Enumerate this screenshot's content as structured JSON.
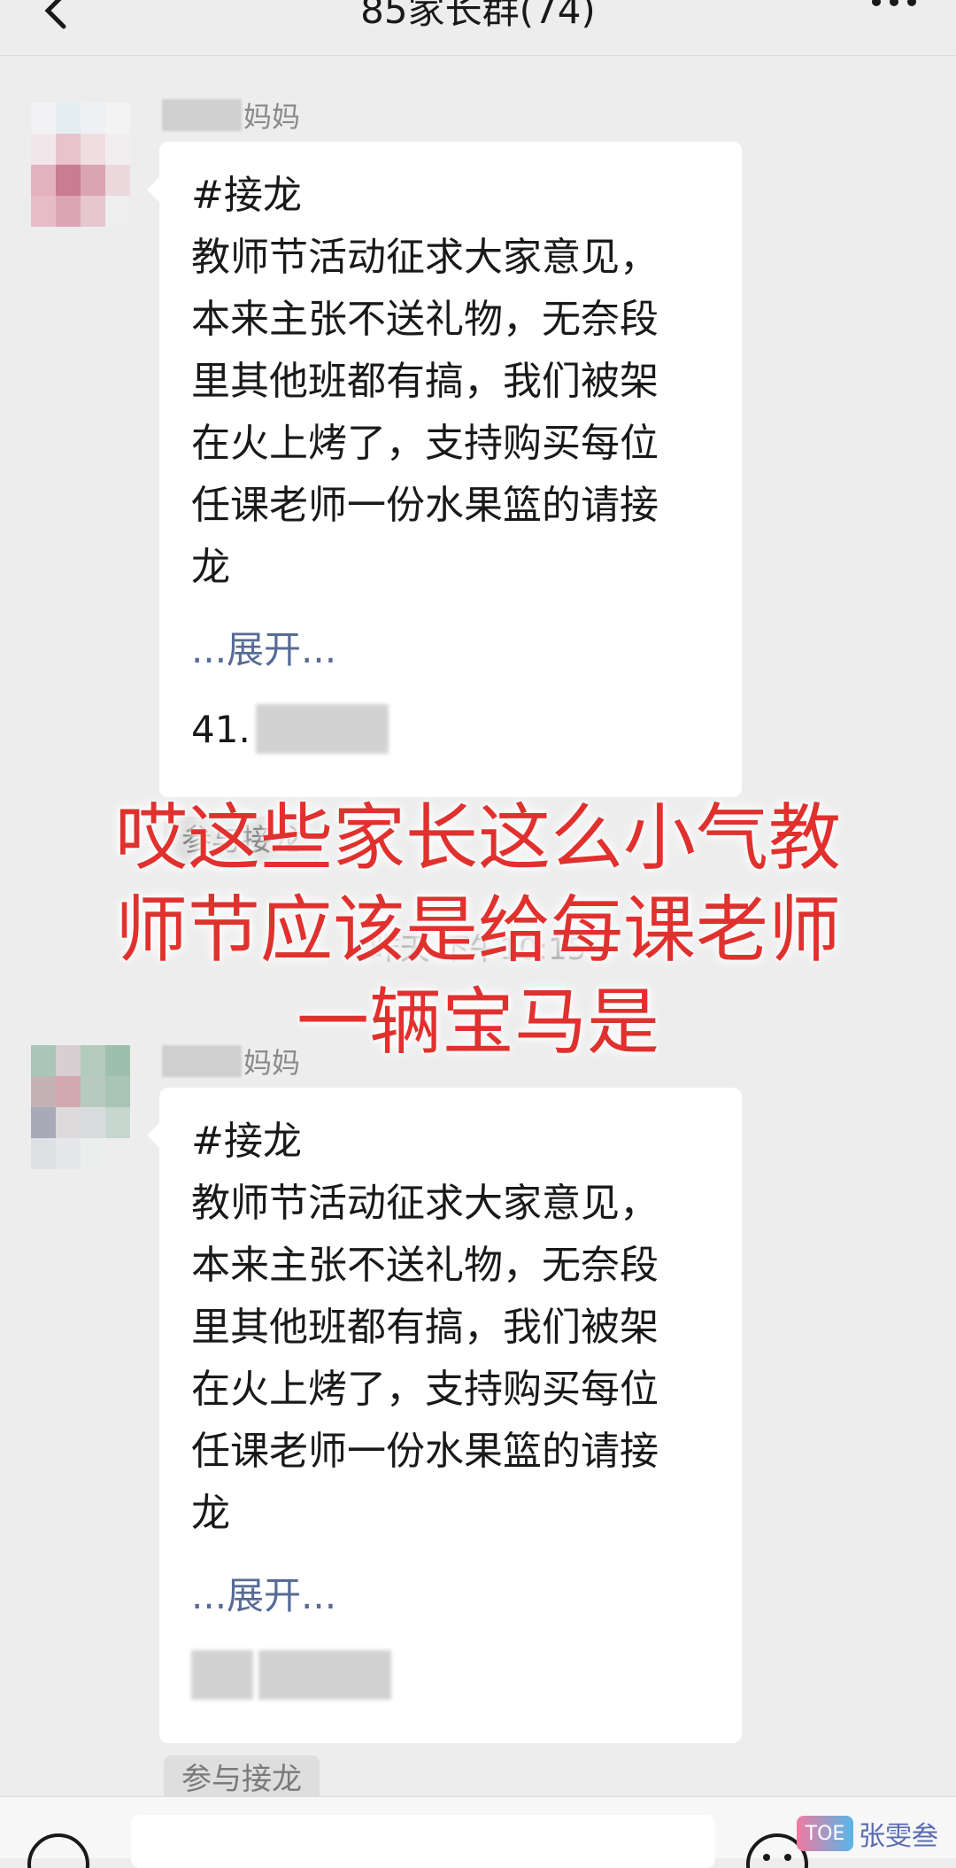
{
  "header": {
    "title": "85家长群(74)"
  },
  "messages": [
    {
      "sender_suffix": "妈妈",
      "text": "#接龙\n教师节活动征求大家意见，\n本来主张不送礼物，无奈段\n里其他班都有搞，我们被架\n在火上烤了，支持购买每位\n任课老师一份水果篮的请接\n龙",
      "expand": "...展开...",
      "entry_prefix": "41.",
      "join_label": "参与接龙"
    },
    {
      "sender_suffix": "妈妈",
      "text": "#接龙\n教师节活动征求大家意见，\n本来主张不送礼物，无奈段\n里其他班都有搞，我们被架\n在火上烤了，支持购买每位\n任课老师一份水果篮的请接\n龙",
      "expand": "...展开...",
      "entry_prefix": "",
      "join_label": "参与接龙"
    }
  ],
  "timestamp": "昨天 下午10:15",
  "overlay_caption": "哎这些家长这么小气教师节应该是给每课老师一辆宝马是",
  "watermark": {
    "logo": "TOE",
    "text": "张雯叁"
  },
  "colors": {
    "background": "#ededed",
    "bubble": "#ffffff",
    "link": "#576b95",
    "caption": "#e0312e"
  },
  "icons": [
    "back-icon",
    "more-icon",
    "voice-icon",
    "emoji-icon"
  ]
}
